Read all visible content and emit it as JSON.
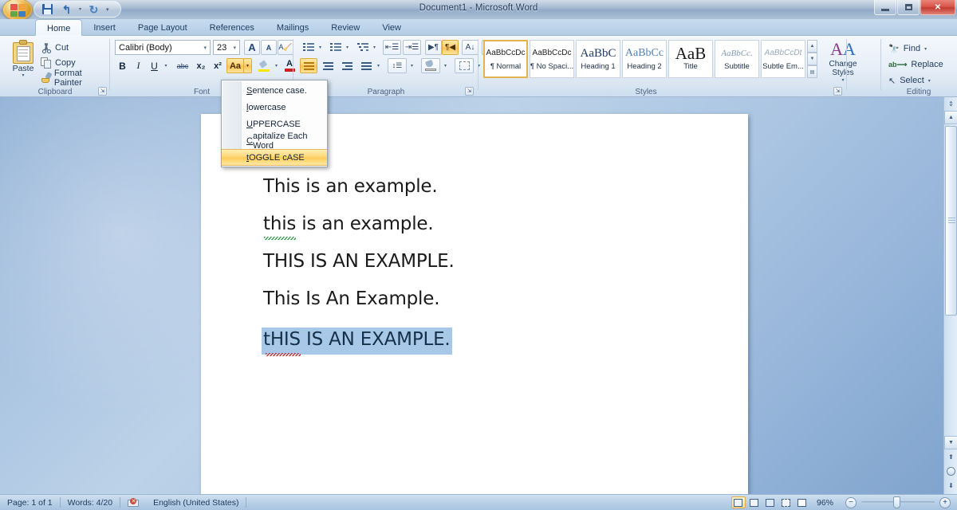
{
  "window": {
    "title": "Document1 - Microsoft Word",
    "office_button": "office-button",
    "minimize": "minimize",
    "maximize": "maximize",
    "close": "close"
  },
  "quick_access": {
    "save": "save-icon",
    "undo": "undo-icon",
    "redo": "redo-icon",
    "customize": "customize-icon"
  },
  "tabs": [
    {
      "label": "Home",
      "active": true
    },
    {
      "label": "Insert",
      "active": false
    },
    {
      "label": "Page Layout",
      "active": false
    },
    {
      "label": "References",
      "active": false
    },
    {
      "label": "Mailings",
      "active": false
    },
    {
      "label": "Review",
      "active": false
    },
    {
      "label": "View",
      "active": false
    }
  ],
  "ribbon": {
    "clipboard": {
      "label": "Clipboard",
      "paste": "Paste",
      "cut": "Cut",
      "copy": "Copy",
      "format_painter": "Format Painter"
    },
    "font": {
      "label": "Font",
      "font_name": "Calibri (Body)",
      "font_size": "23",
      "grow_font": "A",
      "shrink_font": "A",
      "clear_formatting": "Aa",
      "bold": "B",
      "italic": "I",
      "underline": "U",
      "strikethrough": "abc",
      "subscript": "x₂",
      "superscript": "x²",
      "change_case": "Aa",
      "text_highlight": "highlight-icon",
      "font_color": "A"
    },
    "paragraph": {
      "label": "Paragraph",
      "bullets": "bullets-icon",
      "numbering": "numbering-icon",
      "multilevel": "multilevel-list-icon",
      "decrease_indent": "decrease-indent-icon",
      "increase_indent": "increase-indent-icon",
      "ltr": "left-to-right-icon",
      "rtl": "right-to-left-icon",
      "sort": "sort-icon",
      "show_marks": "¶",
      "align_left": "align-left-icon",
      "align_center": "align-center-icon",
      "align_right": "align-right-icon",
      "justify": "justify-icon",
      "line_spacing": "line-spacing-icon",
      "shading": "shading-icon",
      "borders": "borders-icon"
    },
    "styles": {
      "label": "Styles",
      "items": [
        {
          "preview": "AaBbCcDc",
          "name": "¶ Normal",
          "selected": true
        },
        {
          "preview": "AaBbCcDc",
          "name": "¶ No Spaci...",
          "selected": false
        },
        {
          "preview": "AaBbC",
          "name": "Heading 1",
          "selected": false
        },
        {
          "preview": "AaBbCc",
          "name": "Heading 2",
          "selected": false
        },
        {
          "preview": "AaB",
          "name": "Title",
          "selected": false
        },
        {
          "preview": "AaBbCc.",
          "name": "Subtitle",
          "selected": false
        },
        {
          "preview": "AaBbCcDt",
          "name": "Subtle Em...",
          "selected": false
        }
      ],
      "change_styles": "Change Styles"
    },
    "editing": {
      "label": "Editing",
      "find": "Find",
      "replace": "Replace",
      "select": "Select"
    }
  },
  "case_menu": {
    "items": [
      {
        "prefix": "S",
        "rest": "entence case.",
        "highlighted": false
      },
      {
        "prefix": "l",
        "rest": "owercase",
        "highlighted": false
      },
      {
        "prefix": "U",
        "rest": "PPERCASE",
        "highlighted": false
      },
      {
        "prefix": "C",
        "rest": "apitalize Each Word",
        "highlighted": false
      },
      {
        "prefix": "t",
        "rest": "OGGLE cASE",
        "highlighted": true
      }
    ]
  },
  "document": {
    "lines": [
      {
        "text": "This is an example.",
        "selected": false,
        "squiggle": "none"
      },
      {
        "text": "this is an example.",
        "selected": false,
        "squiggle": "green"
      },
      {
        "text": "THIS IS AN EXAMPLE.",
        "selected": false,
        "squiggle": "none"
      },
      {
        "text": "This Is An Example.",
        "selected": false,
        "squiggle": "none"
      },
      {
        "text": "tHIS IS AN EXAMPLE.",
        "selected": true,
        "squiggle": "red"
      }
    ]
  },
  "status_bar": {
    "page": "Page: 1 of 1",
    "words": "Words: 4/20",
    "proofing": "proofing-errors-icon",
    "language": "English (United States)",
    "views": [
      {
        "name": "print-layout-view",
        "selected": true
      },
      {
        "name": "full-screen-reading-view",
        "selected": false
      },
      {
        "name": "web-layout-view",
        "selected": false
      },
      {
        "name": "outline-view",
        "selected": false
      },
      {
        "name": "draft-view",
        "selected": false
      }
    ],
    "zoom": "96%",
    "zoom_out": "−",
    "zoom_in": "+"
  },
  "colors": {
    "accent_orange": "#fcc14f",
    "selection_blue": "#a8c8e8",
    "title_blue": "#26405e",
    "close_red": "#c33c31"
  }
}
